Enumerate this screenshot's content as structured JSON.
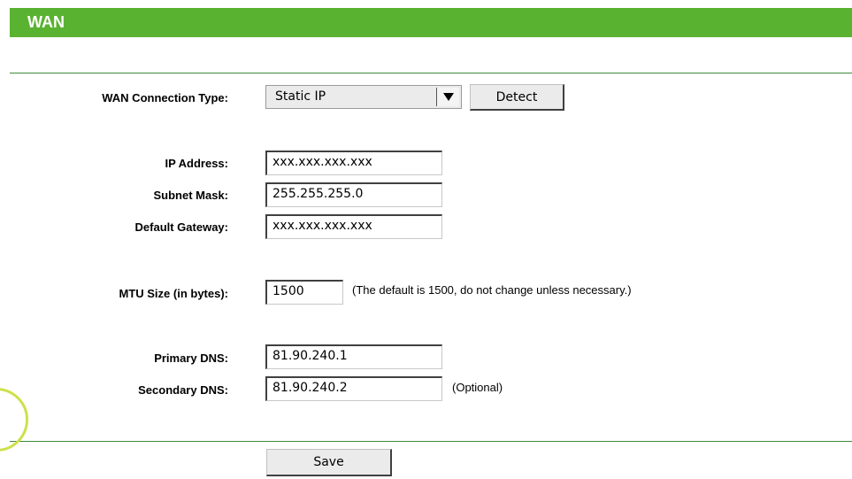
{
  "header": {
    "title": "WAN"
  },
  "wan_connection": {
    "label": "WAN Connection Type:",
    "selected": "Static IP",
    "detect_label": "Detect"
  },
  "ip_address": {
    "label": "IP Address:",
    "value": "xxx.xxx.xxx.xxx"
  },
  "subnet_mask": {
    "label": "Subnet Mask:",
    "value": "255.255.255.0"
  },
  "default_gateway": {
    "label": "Default Gateway:",
    "value": "xxx.xxx.xxx.xxx"
  },
  "mtu": {
    "label": "MTU Size (in bytes):",
    "value": "1500",
    "hint": "(The default is 1500, do not change unless necessary.)"
  },
  "primary_dns": {
    "label": "Primary DNS:",
    "value": "81.90.240.1"
  },
  "secondary_dns": {
    "label": "Secondary DNS:",
    "value": "81.90.240.2",
    "hint": "(Optional)"
  },
  "save_label": "Save",
  "colors": {
    "header_bg": "#5ab231",
    "rule": "#3f8a3c",
    "decoration": "#cde04a"
  },
  "icons": {
    "select_arrow": "chevron-down-icon"
  }
}
